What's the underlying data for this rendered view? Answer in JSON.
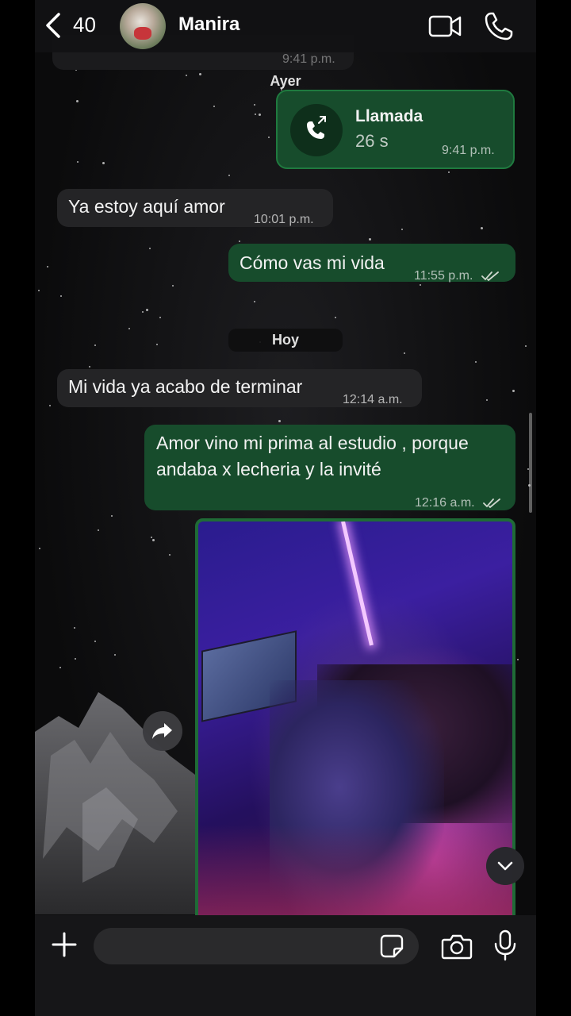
{
  "header": {
    "back_count": "40",
    "contact_name": "Manira"
  },
  "messages": {
    "partial_prev_time": "9:41 p.m.",
    "date_yesterday": "Ayer",
    "call": {
      "title": "Llamada",
      "duration": "26 s",
      "time": "9:41 p.m."
    },
    "m1": {
      "text": "Ya estoy aquí amor",
      "time": "10:01 p.m."
    },
    "m2": {
      "text": "Cómo vas mi vida",
      "time": "11:55 p.m."
    },
    "date_today": "Hoy",
    "m3": {
      "text": "Mi vida ya acabo de terminar",
      "time": "12:14 a.m."
    },
    "m4": {
      "line1": "Amor vino mi prima al estudio , porque",
      "line2": "andaba x lecheria y la invité",
      "time": "12:16 a.m."
    }
  },
  "composer": {
    "placeholder": ""
  },
  "colors": {
    "outgoing_bubble": "#174c2c",
    "incoming_bubble": "#242426",
    "accent_border": "#1f7a3f"
  },
  "icons": [
    "back-chevron-icon",
    "video-camera-icon",
    "phone-icon",
    "call-outgoing-icon",
    "read-ticks-icon",
    "forward-icon",
    "chevron-down-icon",
    "plus-icon",
    "sticker-icon",
    "camera-icon",
    "microphone-icon"
  ]
}
